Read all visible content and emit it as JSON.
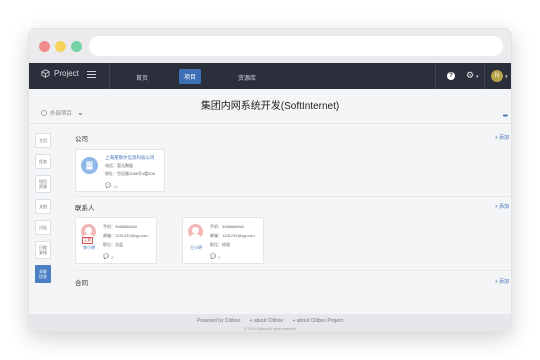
{
  "app": {
    "logo_text": "Project",
    "nav_tabs": [
      "首页",
      "项目",
      "资源库"
    ],
    "active_tab": "项目",
    "help_symbol": "?",
    "gear_symbol": "⚙",
    "avatar_initial": "N"
  },
  "page": {
    "title": "集团内网系统开发(SoftInternet)",
    "breadcrumb_label": "外部项目",
    "more_symbol": "•••"
  },
  "side_tabs": [
    "主页",
    "任务",
    "项目\n资源",
    "文档",
    "讨论",
    "日程\n安排",
    "关联\n信息"
  ],
  "active_side_tab": "关联\n信息",
  "sections": {
    "company_title": "公司",
    "contacts_title": "联系人",
    "contract_title": "合同",
    "add_label": "+ 添加"
  },
  "company": {
    "name": "上海莱斯尔信息科技公司",
    "phone": "电话：暂无数据",
    "address": "地址：世纪路1088号3楼308",
    "comments": "10"
  },
  "contacts": [
    {
      "name": "李小明",
      "tag": "主要",
      "phone": "手机：3986888942",
      "email": "邮箱：1231232@qq.com",
      "position": "职位：总监",
      "comments": "2"
    },
    {
      "name": "王小明",
      "tag": "",
      "phone": "手机：3986888942",
      "email": "邮箱：1231232@qq.com",
      "position": "职位：经理",
      "comments": "2"
    }
  ],
  "footer": {
    "links": [
      "Powered by Citibox",
      "+ about Citibox",
      "+ about Citibox Project"
    ],
    "copyright": "© 2014 Citibox All rights reserved"
  },
  "colors": {
    "navbar": "#2a2f3b",
    "accent": "#3c6fb6",
    "active_side_tab": "#4b7fc4"
  }
}
